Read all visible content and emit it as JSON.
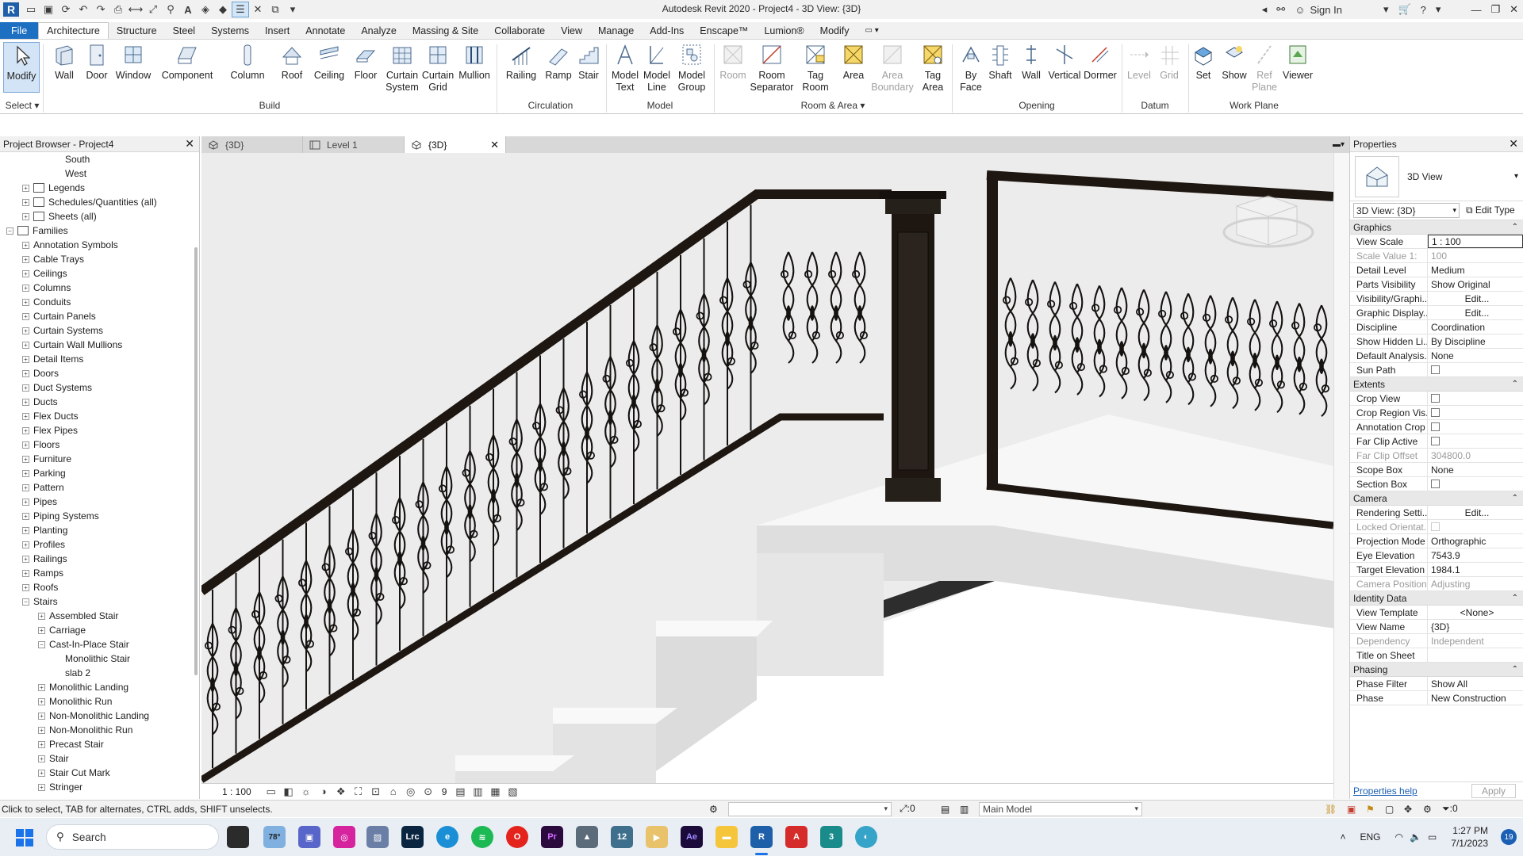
{
  "app": {
    "logo": "R",
    "title": "Autodesk Revit 2020 - Project4 - 3D View: {3D}",
    "sign_in": "Sign In"
  },
  "ribbon_tabs": [
    "File",
    "Architecture",
    "Structure",
    "Steel",
    "Systems",
    "Insert",
    "Annotate",
    "Analyze",
    "Massing & Site",
    "Collaborate",
    "View",
    "Manage",
    "Add-Ins",
    "Enscape™",
    "Lumion®",
    "Modify"
  ],
  "ribbon": {
    "select": {
      "label": "Modify",
      "panel": "Select ▾"
    },
    "build": {
      "panel": "Build",
      "buttons": [
        "Wall",
        "Door",
        "Window",
        "Component",
        "Column",
        "Roof",
        "Ceiling",
        "Floor",
        "Curtain System",
        "Curtain Grid",
        "Mullion"
      ]
    },
    "circulation": {
      "panel": "Circulation",
      "buttons": [
        "Railing",
        "Ramp",
        "Stair"
      ]
    },
    "model": {
      "panel": "Model",
      "buttons": [
        "Model Text",
        "Model Line",
        "Model Group"
      ]
    },
    "room_area": {
      "panel": "Room & Area ▾",
      "buttons": [
        "Room",
        "Room Separator",
        "Tag Room",
        "Area",
        "Area Boundary",
        "Tag Area"
      ]
    },
    "opening": {
      "panel": "Opening",
      "buttons": [
        "By Face",
        "Shaft",
        "Wall",
        "Vertical",
        "Dormer"
      ]
    },
    "datum": {
      "panel": "Datum",
      "buttons": [
        "Level",
        "Grid"
      ]
    },
    "work_plane": {
      "panel": "Work Plane",
      "buttons": [
        "Set",
        "Show",
        "Ref Plane",
        "Viewer"
      ]
    }
  },
  "project_browser": {
    "title": "Project Browser - Project4",
    "items": [
      {
        "label": "South",
        "indent": 3,
        "exp": ""
      },
      {
        "label": "West",
        "indent": 3,
        "exp": ""
      },
      {
        "label": "Legends",
        "indent": 1,
        "exp": "+",
        "icon": true
      },
      {
        "label": "Schedules/Quantities (all)",
        "indent": 1,
        "exp": "+",
        "icon": true
      },
      {
        "label": "Sheets (all)",
        "indent": 1,
        "exp": "+",
        "icon": true
      },
      {
        "label": "Families",
        "indent": 0,
        "exp": "−",
        "icon": true
      },
      {
        "label": "Annotation Symbols",
        "indent": 1,
        "exp": "+"
      },
      {
        "label": "Cable Trays",
        "indent": 1,
        "exp": "+"
      },
      {
        "label": "Ceilings",
        "indent": 1,
        "exp": "+"
      },
      {
        "label": "Columns",
        "indent": 1,
        "exp": "+"
      },
      {
        "label": "Conduits",
        "indent": 1,
        "exp": "+"
      },
      {
        "label": "Curtain Panels",
        "indent": 1,
        "exp": "+"
      },
      {
        "label": "Curtain Systems",
        "indent": 1,
        "exp": "+"
      },
      {
        "label": "Curtain Wall Mullions",
        "indent": 1,
        "exp": "+"
      },
      {
        "label": "Detail Items",
        "indent": 1,
        "exp": "+"
      },
      {
        "label": "Doors",
        "indent": 1,
        "exp": "+"
      },
      {
        "label": "Duct Systems",
        "indent": 1,
        "exp": "+"
      },
      {
        "label": "Ducts",
        "indent": 1,
        "exp": "+"
      },
      {
        "label": "Flex Ducts",
        "indent": 1,
        "exp": "+"
      },
      {
        "label": "Flex Pipes",
        "indent": 1,
        "exp": "+"
      },
      {
        "label": "Floors",
        "indent": 1,
        "exp": "+"
      },
      {
        "label": "Furniture",
        "indent": 1,
        "exp": "+"
      },
      {
        "label": "Parking",
        "indent": 1,
        "exp": "+"
      },
      {
        "label": "Pattern",
        "indent": 1,
        "exp": "+"
      },
      {
        "label": "Pipes",
        "indent": 1,
        "exp": "+"
      },
      {
        "label": "Piping Systems",
        "indent": 1,
        "exp": "+"
      },
      {
        "label": "Planting",
        "indent": 1,
        "exp": "+"
      },
      {
        "label": "Profiles",
        "indent": 1,
        "exp": "+"
      },
      {
        "label": "Railings",
        "indent": 1,
        "exp": "+"
      },
      {
        "label": "Ramps",
        "indent": 1,
        "exp": "+"
      },
      {
        "label": "Roofs",
        "indent": 1,
        "exp": "+"
      },
      {
        "label": "Stairs",
        "indent": 1,
        "exp": "−"
      },
      {
        "label": "Assembled Stair",
        "indent": 2,
        "exp": "+"
      },
      {
        "label": "Carriage",
        "indent": 2,
        "exp": "+"
      },
      {
        "label": "Cast-In-Place Stair",
        "indent": 2,
        "exp": "−"
      },
      {
        "label": "Monolithic Stair",
        "indent": 3,
        "exp": ""
      },
      {
        "label": "slab 2",
        "indent": 3,
        "exp": ""
      },
      {
        "label": "Monolithic Landing",
        "indent": 2,
        "exp": "+"
      },
      {
        "label": "Monolithic Run",
        "indent": 2,
        "exp": "+"
      },
      {
        "label": "Non-Monolithic Landing",
        "indent": 2,
        "exp": "+"
      },
      {
        "label": "Non-Monolithic Run",
        "indent": 2,
        "exp": "+"
      },
      {
        "label": "Precast Stair",
        "indent": 2,
        "exp": "+"
      },
      {
        "label": "Stair",
        "indent": 2,
        "exp": "+"
      },
      {
        "label": "Stair Cut Mark",
        "indent": 2,
        "exp": "+"
      },
      {
        "label": "Stringer",
        "indent": 2,
        "exp": "+"
      }
    ]
  },
  "view_tabs": [
    {
      "label": "{3D}",
      "active": false
    },
    {
      "label": "Level 1",
      "active": false
    },
    {
      "label": "{3D}",
      "active": true
    }
  ],
  "view_bar": {
    "scale": "1 : 100",
    "count": "9"
  },
  "properties": {
    "title": "Properties",
    "type_name": "3D View",
    "selector": "3D View: {3D}",
    "edit_type": "Edit Type",
    "groups": [
      {
        "name": "Graphics",
        "rows": [
          {
            "k": "View Scale",
            "v": "1 : 100",
            "style": "boxed"
          },
          {
            "k": "Scale Value    1:",
            "v": "100",
            "style": "dim"
          },
          {
            "k": "Detail Level",
            "v": "Medium"
          },
          {
            "k": "Parts Visibility",
            "v": "Show Original"
          },
          {
            "k": "Visibility/Graphi...",
            "v": "Edit...",
            "style": "btn"
          },
          {
            "k": "Graphic Display...",
            "v": "Edit...",
            "style": "btn"
          },
          {
            "k": "Discipline",
            "v": "Coordination"
          },
          {
            "k": "Show Hidden Li...",
            "v": "By Discipline"
          },
          {
            "k": "Default Analysis...",
            "v": "None"
          },
          {
            "k": "Sun Path",
            "v": "",
            "style": "cb"
          }
        ]
      },
      {
        "name": "Extents",
        "rows": [
          {
            "k": "Crop View",
            "v": "",
            "style": "cb"
          },
          {
            "k": "Crop Region Vis...",
            "v": "",
            "style": "cb"
          },
          {
            "k": "Annotation Crop",
            "v": "",
            "style": "cb"
          },
          {
            "k": "Far Clip Active",
            "v": "",
            "style": "cb"
          },
          {
            "k": "Far Clip Offset",
            "v": "304800.0",
            "style": "dim"
          },
          {
            "k": "Scope Box",
            "v": "None"
          },
          {
            "k": "Section Box",
            "v": "",
            "style": "cb"
          }
        ]
      },
      {
        "name": "Camera",
        "rows": [
          {
            "k": "Rendering Setti...",
            "v": "Edit...",
            "style": "btn"
          },
          {
            "k": "Locked Orientat...",
            "v": "",
            "style": "cbdim"
          },
          {
            "k": "Projection Mode",
            "v": "Orthographic"
          },
          {
            "k": "Eye Elevation",
            "v": "7543.9"
          },
          {
            "k": "Target Elevation",
            "v": "1984.1"
          },
          {
            "k": "Camera Position",
            "v": "Adjusting",
            "style": "dim"
          }
        ]
      },
      {
        "name": "Identity Data",
        "rows": [
          {
            "k": "View Template",
            "v": "<None>",
            "style": "btn"
          },
          {
            "k": "View Name",
            "v": "{3D}"
          },
          {
            "k": "Dependency",
            "v": "Independent",
            "style": "dim"
          },
          {
            "k": "Title on Sheet",
            "v": ""
          }
        ]
      },
      {
        "name": "Phasing",
        "rows": [
          {
            "k": "Phase Filter",
            "v": "Show All"
          },
          {
            "k": "Phase",
            "v": "New Construction"
          }
        ]
      }
    ],
    "help": "Properties help",
    "apply": "Apply"
  },
  "status": {
    "message": "Click to select, TAB for alternates, CTRL adds, SHIFT unselects.",
    "counter": ":0",
    "model": "Main Model",
    "filter_count": ":0"
  },
  "taskbar": {
    "search": "Search",
    "weather": "78°",
    "lang": "ENG",
    "time": "1:27 PM",
    "date": "7/1/2023",
    "badge": "19"
  },
  "colors": {
    "accent": "#1d6fc2",
    "rail": "#1e1611",
    "stone": "#e2e2e2"
  }
}
